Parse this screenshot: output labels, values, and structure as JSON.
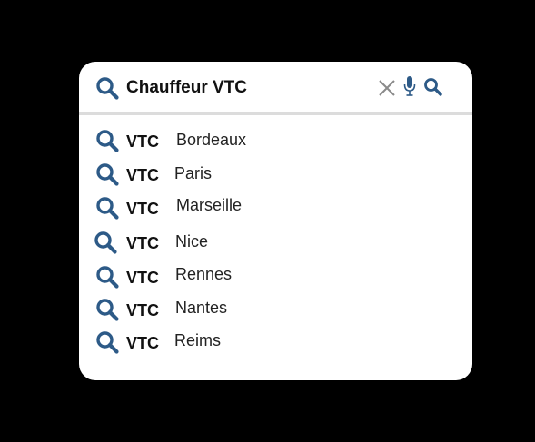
{
  "colors": {
    "accent": "#2d5a87",
    "background": "#000000",
    "card": "#ffffff",
    "divider": "#dcdcdc",
    "muted_icon": "#8a8a8a"
  },
  "search": {
    "query": "Chauffeur VTC",
    "leading_icon": "search-icon",
    "clear_icon": "close-icon",
    "voice_icon": "microphone-icon",
    "submit_icon": "search-icon"
  },
  "suggestions": [
    {
      "strong": "VTC",
      "rest": "Bordeaux"
    },
    {
      "strong": "VTC",
      "rest": "Paris"
    },
    {
      "strong": "VTC",
      "rest": "Marseille"
    },
    {
      "strong": "VTC",
      "rest": "Nice"
    },
    {
      "strong": "VTC",
      "rest": "Rennes"
    },
    {
      "strong": "VTC",
      "rest": "Nantes"
    },
    {
      "strong": "VTC",
      "rest": "Reims"
    }
  ]
}
